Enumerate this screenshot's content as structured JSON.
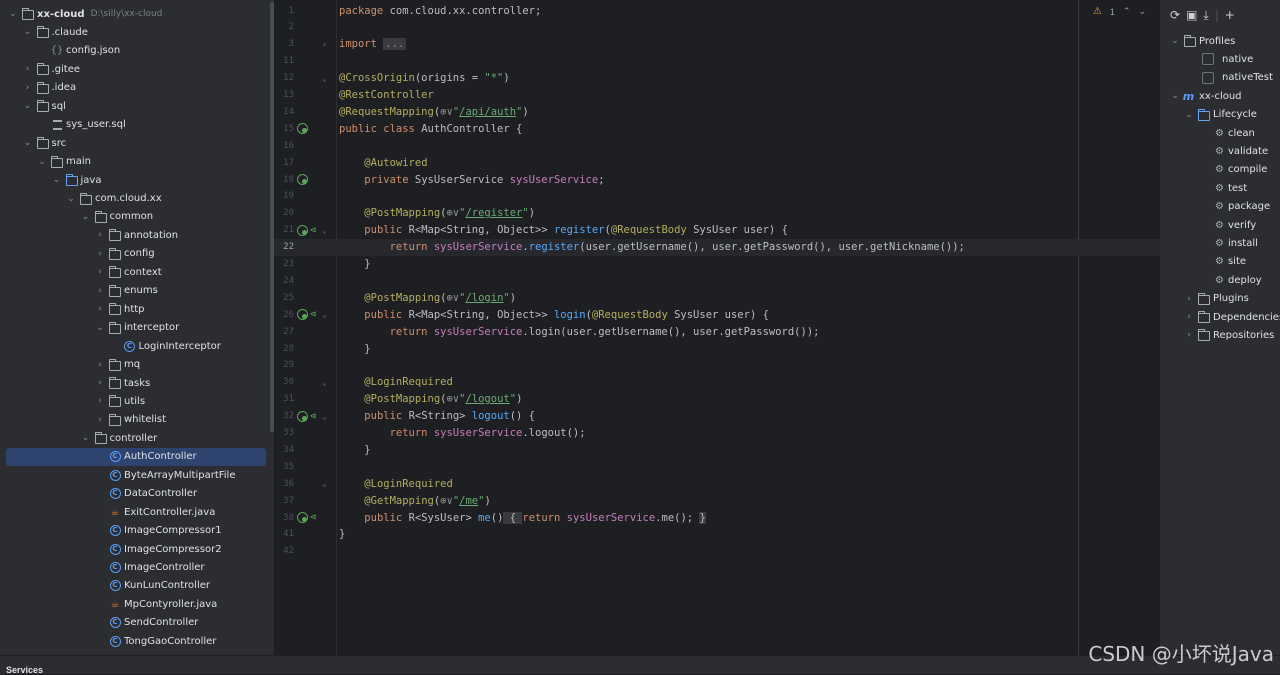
{
  "project": {
    "root_name": "xx-cloud",
    "root_path": "D:\\silly\\xx-cloud",
    "items": [
      {
        "label": "xx-cloud",
        "depth": 0,
        "expanded": true,
        "icon": "folder"
      },
      {
        "label": ".claude",
        "depth": 1,
        "expanded": true,
        "icon": "folder"
      },
      {
        "label": "config.json",
        "depth": 2,
        "icon": "json"
      },
      {
        "label": ".gitee",
        "depth": 1,
        "expanded": false,
        "icon": "folder"
      },
      {
        "label": ".idea",
        "depth": 1,
        "expanded": false,
        "icon": "folder"
      },
      {
        "label": "sql",
        "depth": 1,
        "expanded": true,
        "icon": "folder"
      },
      {
        "label": "sys_user.sql",
        "depth": 2,
        "icon": "sql"
      },
      {
        "label": "src",
        "depth": 1,
        "expanded": true,
        "icon": "folder"
      },
      {
        "label": "main",
        "depth": 2,
        "expanded": true,
        "icon": "folder"
      },
      {
        "label": "java",
        "depth": 3,
        "expanded": true,
        "icon": "folder-blue"
      },
      {
        "label": "com.cloud.xx",
        "depth": 4,
        "expanded": true,
        "icon": "folder"
      },
      {
        "label": "common",
        "depth": 5,
        "expanded": true,
        "icon": "folder"
      },
      {
        "label": "annotation",
        "depth": 6,
        "expanded": false,
        "icon": "folder"
      },
      {
        "label": "config",
        "depth": 6,
        "expanded": false,
        "icon": "folder"
      },
      {
        "label": "context",
        "depth": 6,
        "expanded": false,
        "icon": "folder"
      },
      {
        "label": "enums",
        "depth": 6,
        "expanded": false,
        "icon": "folder"
      },
      {
        "label": "http",
        "depth": 6,
        "expanded": false,
        "icon": "folder"
      },
      {
        "label": "interceptor",
        "depth": 6,
        "expanded": true,
        "icon": "folder"
      },
      {
        "label": "LoginInterceptor",
        "depth": 7,
        "icon": "class"
      },
      {
        "label": "mq",
        "depth": 6,
        "expanded": false,
        "icon": "folder"
      },
      {
        "label": "tasks",
        "depth": 6,
        "expanded": false,
        "icon": "folder"
      },
      {
        "label": "utils",
        "depth": 6,
        "expanded": false,
        "icon": "folder"
      },
      {
        "label": "whitelist",
        "depth": 6,
        "expanded": false,
        "icon": "folder"
      },
      {
        "label": "controller",
        "depth": 5,
        "expanded": true,
        "icon": "folder"
      },
      {
        "label": "AuthController",
        "depth": 6,
        "icon": "class",
        "selected": true
      },
      {
        "label": "ByteArrayMultipartFile",
        "depth": 6,
        "icon": "class"
      },
      {
        "label": "DataController",
        "depth": 6,
        "icon": "class"
      },
      {
        "label": "ExitController.java",
        "depth": 6,
        "icon": "java-file"
      },
      {
        "label": "ImageCompressor1",
        "depth": 6,
        "icon": "class"
      },
      {
        "label": "ImageCompressor2",
        "depth": 6,
        "icon": "class"
      },
      {
        "label": "ImageController",
        "depth": 6,
        "icon": "class"
      },
      {
        "label": "KunLunController",
        "depth": 6,
        "icon": "class"
      },
      {
        "label": "MpContyroller.java",
        "depth": 6,
        "icon": "java-file"
      },
      {
        "label": "SendController",
        "depth": 6,
        "icon": "class"
      },
      {
        "label": "TongGaoController",
        "depth": 6,
        "icon": "class"
      }
    ]
  },
  "editor": {
    "inspection_count": "1",
    "lines": [
      {
        "n": "1",
        "segs": [
          [
            "kw",
            "package "
          ],
          [
            "",
            "com.cloud.xx.controller;"
          ]
        ]
      },
      {
        "n": "2",
        "segs": []
      },
      {
        "n": "3",
        "fold": true,
        "segs": [
          [
            "kw",
            "import "
          ],
          [
            "folded",
            "..."
          ]
        ]
      },
      {
        "n": "11",
        "segs": []
      },
      {
        "n": "12",
        "fold": true,
        "segs": [
          [
            "ann",
            "@CrossOrigin"
          ],
          [
            "",
            "(origins = "
          ],
          [
            "str",
            "\"*\""
          ],
          [
            "",
            ")"
          ]
        ]
      },
      {
        "n": "13",
        "segs": [
          [
            "ann",
            "@RestController"
          ]
        ]
      },
      {
        "n": "14",
        "segs": [
          [
            "ann",
            "@RequestMapping"
          ],
          [
            "",
            "("
          ],
          [
            "globe",
            "⊕∨"
          ],
          [
            "str",
            "\""
          ],
          [
            "url",
            "/api/auth"
          ],
          [
            "str",
            "\""
          ],
          [
            "",
            ")"
          ]
        ]
      },
      {
        "n": "15",
        "gutter": "bean",
        "segs": [
          [
            "kw",
            "public class "
          ],
          [
            "",
            "AuthController {"
          ]
        ]
      },
      {
        "n": "16",
        "segs": []
      },
      {
        "n": "17",
        "segs": [
          [
            "",
            "    "
          ],
          [
            "ann",
            "@Autowired"
          ]
        ]
      },
      {
        "n": "18",
        "gutter": "bean",
        "segs": [
          [
            "",
            "    "
          ],
          [
            "kw",
            "private "
          ],
          [
            "",
            "SysUserService "
          ],
          [
            "field",
            "sysUserService"
          ],
          [
            "",
            ";"
          ]
        ]
      },
      {
        "n": "19",
        "segs": []
      },
      {
        "n": "20",
        "segs": [
          [
            "",
            "    "
          ],
          [
            "ann",
            "@PostMapping"
          ],
          [
            "",
            "("
          ],
          [
            "globe",
            "⊕∨"
          ],
          [
            "str",
            "\""
          ],
          [
            "url",
            "/register"
          ],
          [
            "str",
            "\""
          ],
          [
            "",
            ")"
          ]
        ]
      },
      {
        "n": "21",
        "gutter": "web",
        "fold": true,
        "segs": [
          [
            "",
            "    "
          ],
          [
            "kw",
            "public "
          ],
          [
            "",
            "R<Map<String, Object>> "
          ],
          [
            "method",
            "register"
          ],
          [
            "",
            "("
          ],
          [
            "ann",
            "@RequestBody "
          ],
          [
            "",
            "SysUser user) {"
          ]
        ]
      },
      {
        "n": "22",
        "current": true,
        "segs": [
          [
            "",
            "        "
          ],
          [
            "kw",
            "return "
          ],
          [
            "field",
            "sysUserService"
          ],
          [
            "",
            "."
          ],
          [
            "method",
            "register"
          ],
          [
            "",
            "(user.getUsername(), user.getPassword(), user.getNickname());"
          ]
        ]
      },
      {
        "n": "23",
        "segs": [
          [
            "",
            "    }"
          ]
        ]
      },
      {
        "n": "24",
        "segs": []
      },
      {
        "n": "25",
        "segs": [
          [
            "",
            "    "
          ],
          [
            "ann",
            "@PostMapping"
          ],
          [
            "",
            "("
          ],
          [
            "globe",
            "⊕∨"
          ],
          [
            "str",
            "\""
          ],
          [
            "url",
            "/login"
          ],
          [
            "str",
            "\""
          ],
          [
            "",
            ")"
          ]
        ]
      },
      {
        "n": "26",
        "gutter": "web",
        "fold": true,
        "segs": [
          [
            "",
            "    "
          ],
          [
            "kw",
            "public "
          ],
          [
            "",
            "R<Map<String, Object>> "
          ],
          [
            "method",
            "login"
          ],
          [
            "",
            "("
          ],
          [
            "ann",
            "@RequestBody "
          ],
          [
            "",
            "SysUser user) {"
          ]
        ]
      },
      {
        "n": "27",
        "segs": [
          [
            "",
            "        "
          ],
          [
            "kw",
            "return "
          ],
          [
            "field",
            "sysUserService"
          ],
          [
            "",
            ".login(user.getUsername(), user.getPassword());"
          ]
        ]
      },
      {
        "n": "28",
        "segs": [
          [
            "",
            "    }"
          ]
        ]
      },
      {
        "n": "29",
        "segs": []
      },
      {
        "n": "30",
        "fold": true,
        "segs": [
          [
            "",
            "    "
          ],
          [
            "ann",
            "@LoginRequired"
          ]
        ]
      },
      {
        "n": "31",
        "segs": [
          [
            "",
            "    "
          ],
          [
            "ann",
            "@PostMapping"
          ],
          [
            "",
            "("
          ],
          [
            "globe",
            "⊕∨"
          ],
          [
            "str",
            "\""
          ],
          [
            "url",
            "/logout"
          ],
          [
            "str",
            "\""
          ],
          [
            "",
            ")"
          ]
        ]
      },
      {
        "n": "32",
        "gutter": "web",
        "fold": true,
        "segs": [
          [
            "",
            "    "
          ],
          [
            "kw",
            "public "
          ],
          [
            "",
            "R<String> "
          ],
          [
            "method",
            "logout"
          ],
          [
            "",
            "() {"
          ]
        ]
      },
      {
        "n": "33",
        "segs": [
          [
            "",
            "        "
          ],
          [
            "kw",
            "return "
          ],
          [
            "field",
            "sysUserService"
          ],
          [
            "",
            ".logout();"
          ]
        ]
      },
      {
        "n": "34",
        "segs": [
          [
            "",
            "    }"
          ]
        ]
      },
      {
        "n": "35",
        "segs": []
      },
      {
        "n": "36",
        "fold": true,
        "segs": [
          [
            "",
            "    "
          ],
          [
            "ann",
            "@LoginRequired"
          ]
        ]
      },
      {
        "n": "37",
        "segs": [
          [
            "",
            "    "
          ],
          [
            "ann",
            "@GetMapping"
          ],
          [
            "",
            "("
          ],
          [
            "globe",
            "⊕∨"
          ],
          [
            "str",
            "\""
          ],
          [
            "url",
            "/me"
          ],
          [
            "str",
            "\""
          ],
          [
            "",
            ")"
          ]
        ]
      },
      {
        "n": "38",
        "gutter": "web",
        "segs": [
          [
            "",
            "    "
          ],
          [
            "kw",
            "public "
          ],
          [
            "",
            "R<SysUser> "
          ],
          [
            "method",
            "me"
          ],
          [
            "",
            "()"
          ],
          [
            "brace-hl",
            " { "
          ],
          [
            "kw",
            "return "
          ],
          [
            "field",
            "sysUserService"
          ],
          [
            "",
            ".me(); "
          ],
          [
            "brace-hl",
            "}"
          ]
        ]
      },
      {
        "n": "41",
        "segs": [
          [
            "",
            "}"
          ]
        ]
      },
      {
        "n": "42",
        "segs": []
      }
    ]
  },
  "maven": {
    "items": [
      {
        "label": "Profiles",
        "depth": 0,
        "type": "folder",
        "expanded": true
      },
      {
        "label": "native",
        "depth": 1,
        "type": "checkbox"
      },
      {
        "label": "nativeTest",
        "depth": 1,
        "type": "checkbox"
      },
      {
        "label": "xx-cloud",
        "depth": 0,
        "type": "module",
        "expanded": true
      },
      {
        "label": "Lifecycle",
        "depth": 1,
        "type": "folder",
        "expanded": true
      },
      {
        "label": "clean",
        "depth": 2,
        "type": "goal"
      },
      {
        "label": "validate",
        "depth": 2,
        "type": "goal"
      },
      {
        "label": "compile",
        "depth": 2,
        "type": "goal"
      },
      {
        "label": "test",
        "depth": 2,
        "type": "goal"
      },
      {
        "label": "package",
        "depth": 2,
        "type": "goal"
      },
      {
        "label": "verify",
        "depth": 2,
        "type": "goal"
      },
      {
        "label": "install",
        "depth": 2,
        "type": "goal"
      },
      {
        "label": "site",
        "depth": 2,
        "type": "goal"
      },
      {
        "label": "deploy",
        "depth": 2,
        "type": "goal"
      },
      {
        "label": "Plugins",
        "depth": 1,
        "type": "folder",
        "expanded": false
      },
      {
        "label": "Dependencies",
        "depth": 1,
        "type": "folder",
        "expanded": false
      },
      {
        "label": "Repositories",
        "depth": 1,
        "type": "folder",
        "expanded": false
      }
    ],
    "toolbar_icons": [
      "reload-icon",
      "add-module-icon",
      "download-icon",
      "add-icon"
    ]
  },
  "bottom": {
    "services_label": "Services",
    "watermark": "CSDN @小坏说Java"
  }
}
